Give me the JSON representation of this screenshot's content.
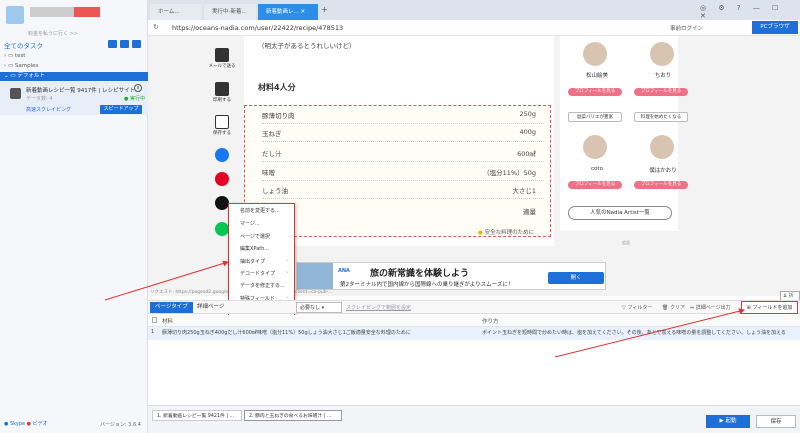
{
  "sidebar": {
    "username_sub": "料金を私うに行く >>",
    "all_tasks": "全てのタスク",
    "tree": [
      "test",
      "Samples"
    ],
    "default_group": "デフォルト",
    "task": {
      "title": "新着動画レシピ一覧 9417件 | レシピサイト...",
      "meta": "データ数: 4",
      "status": "● 実行中",
      "cloud": "高速スクレイピング",
      "speedup": "スピードアップ"
    },
    "footer_links": [
      "Skype",
      "ビデオ"
    ],
    "version": "バージョン: 3.6.4"
  },
  "browser": {
    "tabs": [
      "ホーム...",
      "実行中-新着...",
      "新着動画レ..."
    ],
    "new_tab": "+",
    "url": "https://oceans-nadia.com/user/22422/recipe/478513",
    "login": "事前ログイン",
    "pc_browser": "PCブラウザ",
    "window_controls": "◎ ⚙ ? — ☐ ✕"
  },
  "recipe": {
    "note": "（明太子があるとうれしいけど）",
    "ingredients_title": "材料4人分",
    "ingredients": [
      {
        "name": "豚薄切り肉",
        "amount": "250g"
      },
      {
        "name": "玉ねぎ",
        "amount": "400g"
      },
      {
        "name": "だし汁",
        "amount": "600㎖"
      },
      {
        "name": "味噌",
        "amount": "（塩分11%）50g"
      },
      {
        "name": "しょう油",
        "amount": "大さじ1"
      },
      {
        "name": "",
        "amount": "適量"
      }
    ],
    "safe_note": "安全な料理のために",
    "social": {
      "mail": "メールで送る",
      "print": "印刷する",
      "save": "保存する"
    }
  },
  "artists": {
    "names": [
      "松山絵美",
      "ちおり",
      "coto",
      "僕はかおり"
    ],
    "profile_btn": "プロフィールを見る",
    "tags": [
      "副菜バリエが豊富",
      "料理を始めたくなる"
    ],
    "popular": "人気のNadia Artist一覧",
    "ad_label": "広告"
  },
  "context_menu": {
    "items": [
      "名前を変更する...",
      "マージ...",
      "ページで選択",
      "編集XPath...",
      "抽出タイプ",
      "デコードタイプ",
      "データを修正する...",
      "特殊フィールド"
    ],
    "delete": "列を削除"
  },
  "ad": {
    "logo": "ANA",
    "title": "旅の新常識を体験しよう",
    "sub": "第2ターミナル内で国内線から国際線への乗り継ぎがよりスムーズに！",
    "button": "開く"
  },
  "request_text": "リクエスト: https://pagead2.googlesyndication.com/pagead/ads?client=ca-pub-...",
  "fold": "折る",
  "data_panel": {
    "tabs": [
      "ページタイプ",
      "詳細ページ"
    ],
    "select": "必要なし",
    "scroll_link": "スクレイピングで範囲を設定",
    "tools": [
      "フィルター",
      "クリア",
      "詳細ページ出力"
    ],
    "add_field": "フィールドを追加",
    "columns": [
      "材料",
      "作り方"
    ],
    "rows": [
      {
        "index": "1",
        "material": "豚薄切り肉250g玉ねぎ400gだし汁600㎖味噌（塩分11%）50gしょう油大さじ1ご飯適量安全な料理のために",
        "method": "ポイント玉ねぎを短時間で炒めたい時は、塩を加えてください。その後、あとで加える味噌の量を調整してください。しょう油を加える"
      }
    ]
  },
  "bottom": {
    "tabs": [
      "1. 新着動画レシピ一覧 9421件 | ...",
      "2. 豚肉と玉ねぎの食べるお味噌汁 | ..."
    ],
    "start": "▶ 起動",
    "save": "保存"
  }
}
